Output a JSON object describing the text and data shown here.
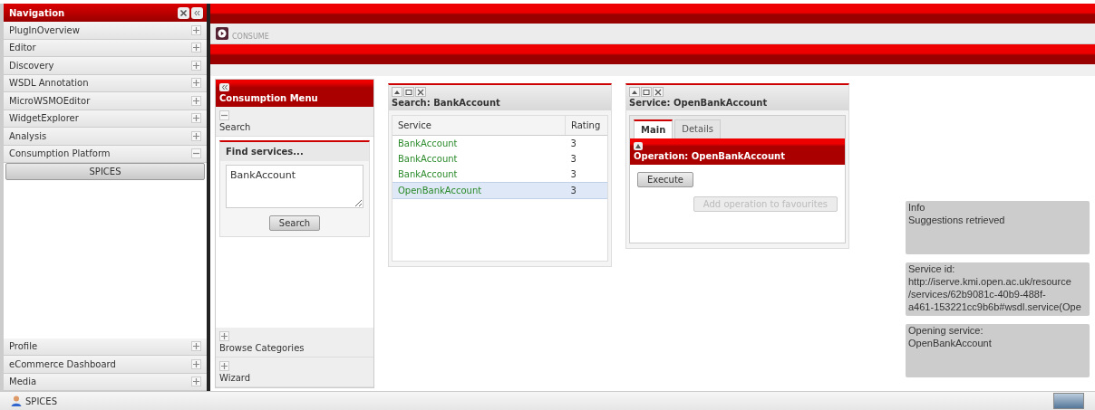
{
  "navigation": {
    "title": "Navigation",
    "items": [
      {
        "label": "PlugInOverview",
        "expanded": false
      },
      {
        "label": "Editor",
        "expanded": false
      },
      {
        "label": "Discovery",
        "expanded": false
      },
      {
        "label": "WSDL Annotation",
        "expanded": false
      },
      {
        "label": "MicroWSMOEditor",
        "expanded": false
      },
      {
        "label": "WidgetExplorer",
        "expanded": false
      },
      {
        "label": "Analysis",
        "expanded": false
      },
      {
        "label": "Consumption Platform",
        "expanded": true,
        "children": [
          {
            "label": "SPICES"
          }
        ]
      }
    ],
    "bottom_items": [
      {
        "label": "Profile",
        "expanded": false
      },
      {
        "label": "eCommerce Dashboard",
        "expanded": false
      },
      {
        "label": "Media",
        "expanded": false
      }
    ]
  },
  "app_tab": {
    "label": "CONSUME"
  },
  "consumption_menu": {
    "title": "Consumption Menu",
    "sections": [
      {
        "label": "Search",
        "expanded": true
      },
      {
        "label": "Browse Categories",
        "expanded": false
      },
      {
        "label": "Wizard",
        "expanded": false
      }
    ],
    "find": {
      "title": "Find services...",
      "value": "BankAccount",
      "button": "Search"
    }
  },
  "search_panel": {
    "title": "Search: BankAccount",
    "columns": [
      "Service",
      "Rating"
    ],
    "rows": [
      {
        "service": "BankAccount",
        "rating": "3",
        "selected": false
      },
      {
        "service": "BankAccount",
        "rating": "3",
        "selected": false
      },
      {
        "service": "BankAccount",
        "rating": "3",
        "selected": false
      },
      {
        "service": "OpenBankAccount",
        "rating": "3",
        "selected": true
      }
    ]
  },
  "service_panel": {
    "title": "Service: OpenBankAccount",
    "tabs": [
      {
        "label": "Main",
        "selected": true
      },
      {
        "label": "Details",
        "selected": false
      }
    ],
    "operation": {
      "title": "Operation: OpenBankAccount",
      "execute": "Execute",
      "favourite": "Add operation to favourites",
      "favourite_disabled": true
    }
  },
  "notifications": [
    {
      "lines": [
        "Info",
        "Suggestions retrieved"
      ]
    },
    {
      "lines": [
        "Service id:",
        "http://iserve.kmi.open.ac.uk/resource",
        "/services/62b9081c-40b9-488f-",
        "a461-153221cc9b6b#wsdl.service(Ope"
      ]
    },
    {
      "lines": [
        "Opening service:",
        "OpenBankAccount"
      ]
    }
  ],
  "status_bar": {
    "user": "SPICES"
  }
}
